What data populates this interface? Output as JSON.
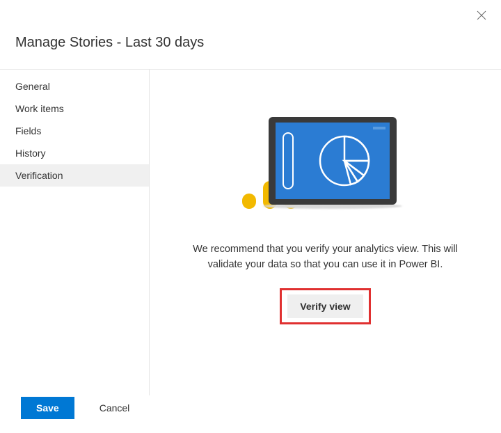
{
  "header": {
    "title": "Manage Stories - Last 30 days"
  },
  "sidebar": {
    "items": [
      {
        "label": "General",
        "selected": false
      },
      {
        "label": "Work items",
        "selected": false
      },
      {
        "label": "Fields",
        "selected": false
      },
      {
        "label": "History",
        "selected": false
      },
      {
        "label": "Verification",
        "selected": true
      }
    ]
  },
  "main": {
    "description": "We recommend that you verify your analytics view. This will validate your data so that you can use it in Power BI.",
    "verify_button": "Verify view"
  },
  "footer": {
    "save_label": "Save",
    "cancel_label": "Cancel"
  },
  "colors": {
    "primary": "#0078d4",
    "highlight_border": "#e03030",
    "illustration_yellow": "#f2b900",
    "illustration_blue": "#2b7cd3"
  }
}
